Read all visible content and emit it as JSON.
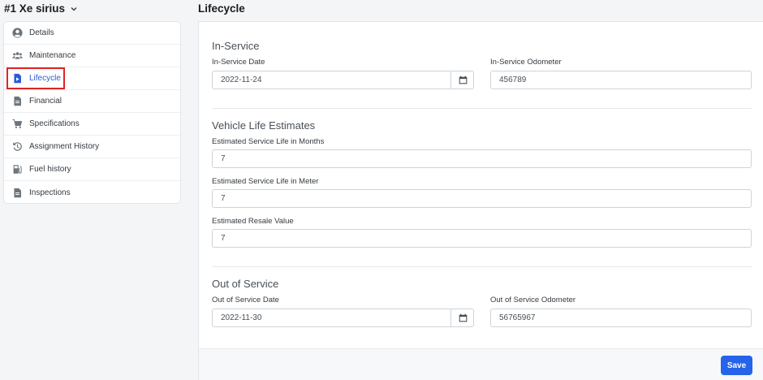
{
  "vehicle": {
    "title": "#1 Xe sirius",
    "dropdown_icon": "chevron-down-icon"
  },
  "sidebar": {
    "items": [
      {
        "label": "Details",
        "icon": "user-circle-icon",
        "active": false
      },
      {
        "label": "Maintenance",
        "icon": "users-icon",
        "active": false
      },
      {
        "label": "Lifecycle",
        "icon": "file-play-icon",
        "active": true
      },
      {
        "label": "Financial",
        "icon": "file-icon",
        "active": false
      },
      {
        "label": "Specifications",
        "icon": "cart-icon",
        "active": false
      },
      {
        "label": "Assignment History",
        "icon": "history-icon",
        "active": false
      },
      {
        "label": "Fuel history",
        "icon": "fuel-pump-icon",
        "active": false
      },
      {
        "label": "Inspections",
        "icon": "file-icon",
        "active": false
      }
    ]
  },
  "page": {
    "title": "Lifecycle"
  },
  "in_service": {
    "heading": "In-Service",
    "date_label": "In-Service Date",
    "date_value": "2022-11-24",
    "odometer_label": "In-Service Odometer",
    "odometer_value": "456789"
  },
  "life_estimates": {
    "heading": "Vehicle Life Estimates",
    "months_label": "Estimated Service Life in Months",
    "months_value": "7",
    "meter_label": "Estimated Service Life in Meter",
    "meter_value": "7",
    "resale_label": "Estimated Resale Value",
    "resale_value": "7"
  },
  "out_of_service": {
    "heading": "Out of Service",
    "date_label": "Out of Service Date",
    "date_value": "2022-11-30",
    "odometer_label": "Out of Service Odometer",
    "odometer_value": "56765967"
  },
  "footer": {
    "save_label": "Save"
  },
  "colors": {
    "accent": "#2563eb",
    "active_link": "#2d5bd8",
    "highlight_outline": "#e02424"
  }
}
